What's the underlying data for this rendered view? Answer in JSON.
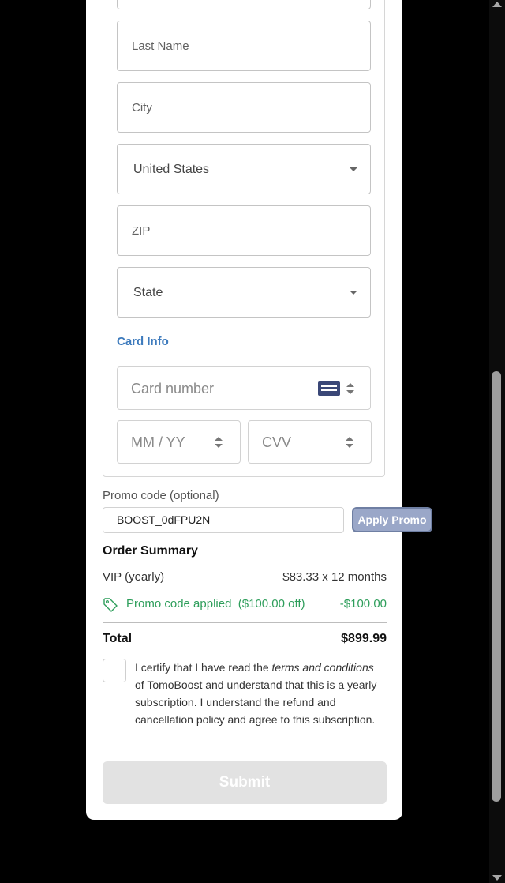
{
  "form": {
    "fields": {
      "first_name": "",
      "last_name": "Last Name",
      "city": "City",
      "country": "United States",
      "zip": "ZIP",
      "state": "State"
    },
    "card_info": {
      "section_label": "Card Info",
      "card_number_placeholder": "Card number",
      "expiry_placeholder": "MM / YY",
      "cvv_placeholder": "CVV"
    },
    "promo": {
      "label": "Promo code (optional)",
      "value": "BOOST_0dFPU2N",
      "apply_label": "Apply Promo"
    }
  },
  "order_summary": {
    "title": "Order Summary",
    "plan_name": "VIP (yearly)",
    "plan_price_struck": "$83.33 x 12 months",
    "promo_applied_text": "Promo code applied  ($100.00 off)",
    "promo_amount": "-$100.00",
    "total_label": "Total",
    "total_value": "$899.99"
  },
  "terms": {
    "checked": false,
    "part1": "I certify that I have read the ",
    "emphasis": "terms and conditions",
    "part2": " of TomoBoost and understand that this is a yearly subscription. I understand the refund and cancellation policy and agree to this subscription."
  },
  "submit_label": "Submit",
  "icons": {
    "select_caret": "chevron-down-icon",
    "card": "credit-card-icon",
    "spinner": "spinner-arrows-icon",
    "tag": "tag-icon"
  },
  "colors": {
    "accent": "#3e7bbd",
    "success": "#2e9e5b",
    "apply_button": "#9aa7c8",
    "submit_disabled": "#e2e2e2"
  }
}
